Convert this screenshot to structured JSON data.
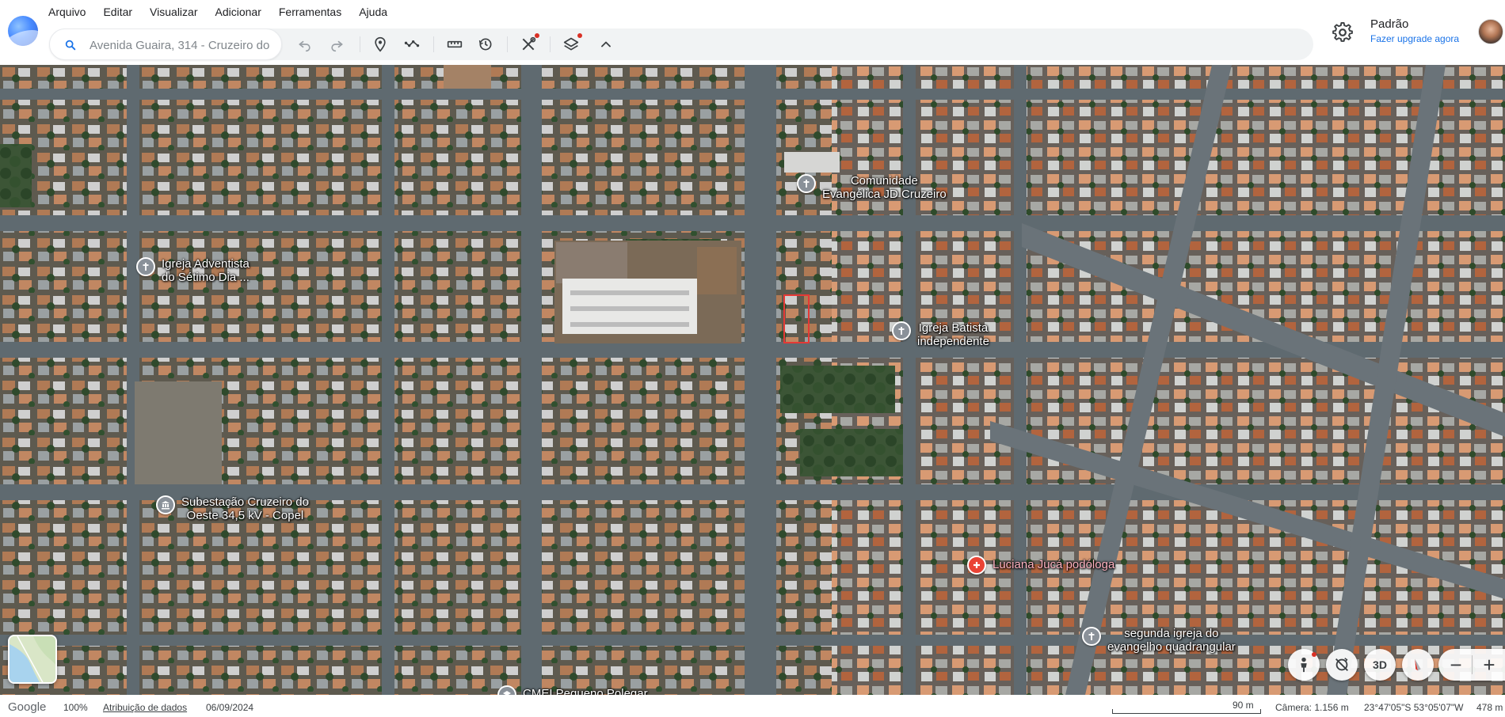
{
  "menu": {
    "items": [
      "Arquivo",
      "Editar",
      "Visualizar",
      "Adicionar",
      "Ferramentas",
      "Ajuda"
    ]
  },
  "toolbar": {
    "search_value": "Avenida Guaira, 314 - Cruzeiro do",
    "icons": [
      "undo-icon",
      "redo-icon",
      "placemark-icon",
      "path-icon",
      "measure-icon",
      "historical-imagery-icon",
      "tools-icon",
      "layers-icon",
      "collapse-icon"
    ]
  },
  "account": {
    "plan": "Padrão",
    "upgrade": "Fazer upgrade agora"
  },
  "places": [
    {
      "name": "Comunidade\nEvangélica JD Cruzeiro",
      "icon": "church-icon"
    },
    {
      "name": "Igreja Adventista\ndo Sétimo Dia ...",
      "icon": "church-icon"
    },
    {
      "name": "Igreja Batista\nindependente",
      "icon": "church-icon"
    },
    {
      "name": "Subestação Cruzeiro do\nOeste 34,5 kV - Copel",
      "icon": "building-icon"
    },
    {
      "name": "Luciana Jucá podóloga",
      "icon": "medical-icon"
    },
    {
      "name": "segunda igreja do\nevangelho quadrangular",
      "icon": "church-icon"
    },
    {
      "name": "CMEI Pequeno Polegar",
      "icon": "school-icon"
    }
  ],
  "map_controls": {
    "tilt_label": "3D"
  },
  "status": {
    "brand": "Google",
    "loaded": "100%",
    "attribution": "Atribuição de dados",
    "imagery_date": "06/09/2024",
    "scale": "90 m",
    "camera": "Câmera: 1.156 m",
    "coordinates": "23°47'05\"S 53°05'07\"W",
    "elevation": "478 m"
  },
  "colors": {
    "accent": "#1a73e8",
    "selection": "#e53935",
    "poi_red": "#ea4335"
  }
}
